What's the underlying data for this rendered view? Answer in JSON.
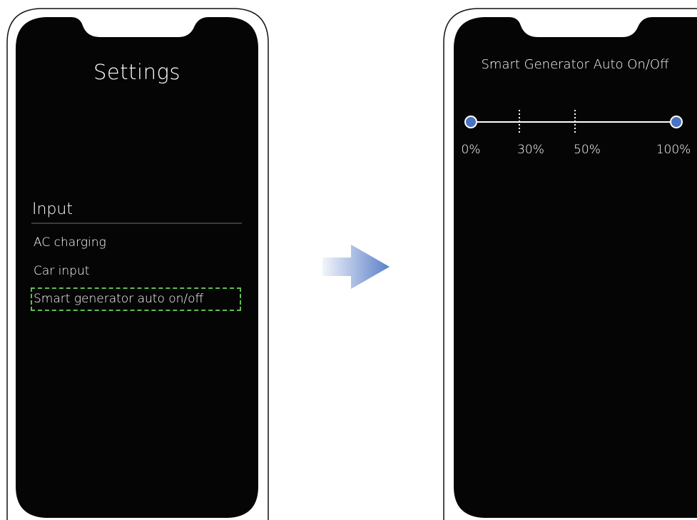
{
  "settings_screen": {
    "title": "Settings",
    "section_header": "Input",
    "items": [
      {
        "label": "AC charging"
      },
      {
        "label": "Car input"
      },
      {
        "label": "Smart generator auto on/off",
        "highlighted": true
      }
    ]
  },
  "generator_screen": {
    "title": "Smart Generator Auto On/Off",
    "slider": {
      "min_label": "0%",
      "mark_30_label": "30%",
      "mark_50_label": "50%",
      "max_label": "100%",
      "start_percent": 0,
      "end_percent": 100,
      "marks_percent": [
        30,
        50
      ]
    }
  },
  "colors": {
    "screen_background": "#050505",
    "knob": "#4a72c2",
    "highlight_border": "#5fbf4f",
    "arrow_start": "#f2f4fa",
    "arrow_end": "#5b80c8"
  }
}
